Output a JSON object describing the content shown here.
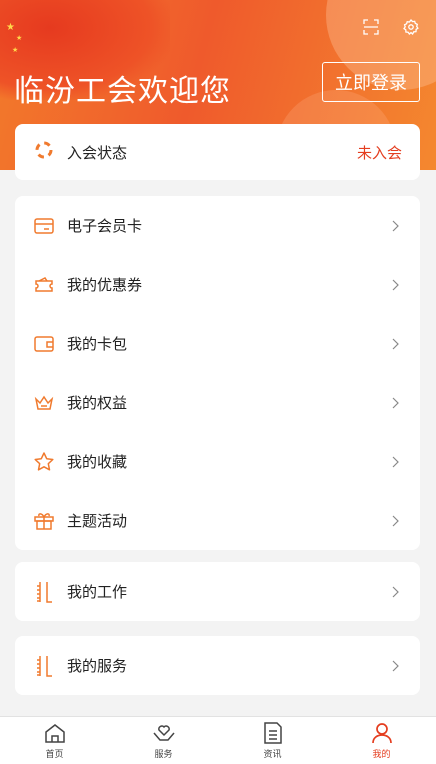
{
  "header": {
    "welcome": "临汾工会欢迎您",
    "login_label": "立即登录"
  },
  "status": {
    "label": "入会状态",
    "value": "未入会"
  },
  "menu_group_1": [
    {
      "label": "电子会员卡",
      "icon": "member-card-icon"
    },
    {
      "label": "我的优惠券",
      "icon": "coupon-icon"
    },
    {
      "label": "我的卡包",
      "icon": "wallet-icon"
    },
    {
      "label": "我的权益",
      "icon": "crown-icon"
    },
    {
      "label": "我的收藏",
      "icon": "star-icon"
    },
    {
      "label": "主题活动",
      "icon": "gift-icon"
    }
  ],
  "menu_group_2": [
    {
      "label": "我的工作",
      "icon": "notebook-icon"
    }
  ],
  "menu_group_3": [
    {
      "label": "我的服务",
      "icon": "notebook-icon"
    }
  ],
  "tabbar": [
    {
      "label": "首页",
      "icon": "home-icon"
    },
    {
      "label": "服务",
      "icon": "heart-hand-icon"
    },
    {
      "label": "资讯",
      "icon": "news-icon"
    },
    {
      "label": "我的",
      "icon": "person-icon",
      "active": true
    }
  ],
  "colors": {
    "accent": "#e43d1f",
    "icon_orange": "#f07a2e"
  }
}
